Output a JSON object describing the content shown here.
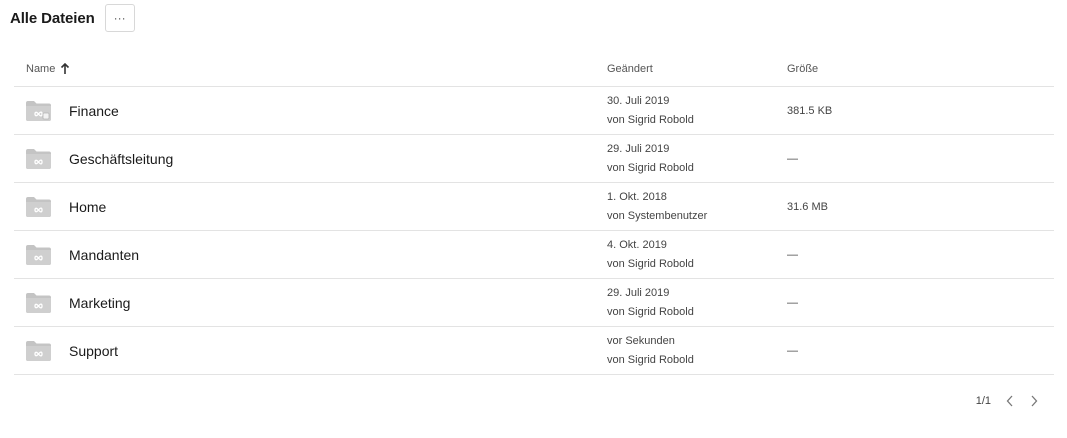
{
  "header": {
    "title": "Alle Dateien",
    "more_label": "···"
  },
  "columns": {
    "name": "Name",
    "modified": "Geändert",
    "size": "Größe"
  },
  "rows": [
    {
      "name": "Finance",
      "date": "30. Juli 2019",
      "by": "von Sigrid Robold",
      "size": "381.5 KB",
      "icon": "shared-folder-icon"
    },
    {
      "name": "Geschäftsleitung",
      "date": "29. Juli 2019",
      "by": "von Sigrid Robold",
      "size": "—",
      "icon": "folder-icon"
    },
    {
      "name": "Home",
      "date": "1. Okt. 2018",
      "by": "von Systembenutzer",
      "size": "31.6 MB",
      "icon": "folder-icon"
    },
    {
      "name": "Mandanten",
      "date": "4. Okt. 2019",
      "by": "von Sigrid Robold",
      "size": "—",
      "icon": "folder-icon"
    },
    {
      "name": "Marketing",
      "date": "29. Juli 2019",
      "by": "von Sigrid Robold",
      "size": "—",
      "icon": "folder-icon"
    },
    {
      "name": "Support",
      "date": "vor Sekunden",
      "by": "von Sigrid Robold",
      "size": "—",
      "icon": "folder-icon"
    }
  ],
  "pager": {
    "page": "1/1"
  }
}
